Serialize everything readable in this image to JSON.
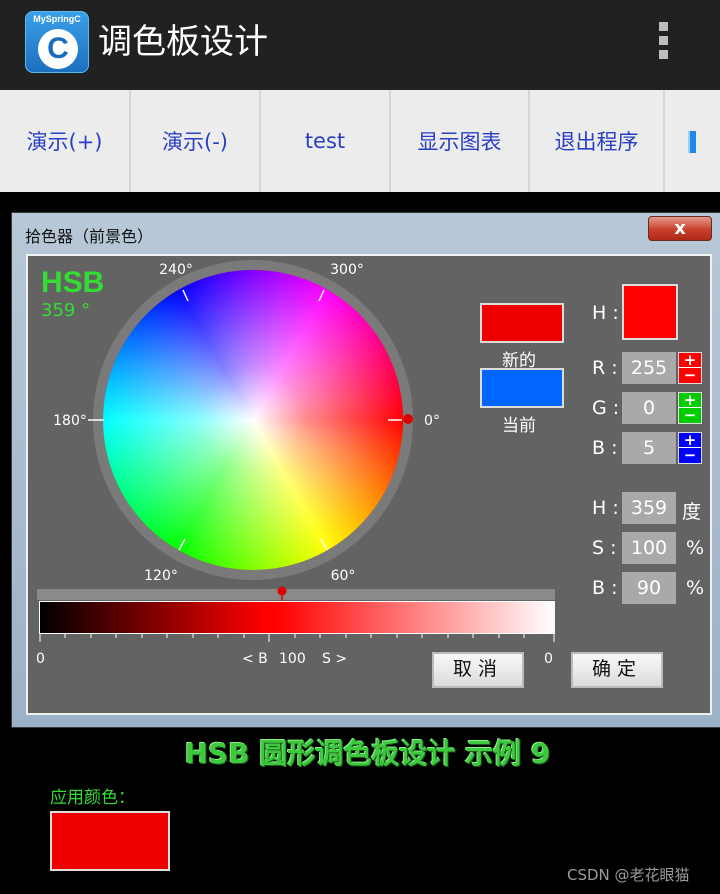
{
  "app_bar": {
    "title": "调色板设计",
    "icon_text": "MySpringC",
    "icon_letter": "C",
    "overflow_icon": "overflow-menu-icon"
  },
  "toolbar": {
    "buttons": [
      "演示(+)",
      "演示(-)",
      "test",
      "显示图表",
      "退出程序"
    ]
  },
  "dialog": {
    "title": "拾色器（前景色）",
    "close_glyph": "x",
    "mode_label": "HSB",
    "hue_readout": "359 °",
    "wheel_angles": [
      "240°",
      "300°",
      "180°",
      "0°",
      "120°",
      "60°"
    ],
    "new_label": "新的",
    "current_label": "当前",
    "new_color": "#ee0000",
    "current_color": "#0066ff",
    "preview_color": "#ff0000",
    "rgb": [
      {
        "label": "R :",
        "value": "255",
        "accent": "#ff0000"
      },
      {
        "label": "G :",
        "value": "0",
        "accent": "#00cc00"
      },
      {
        "label": "B :",
        "value": "5",
        "accent": "#0000ff"
      }
    ],
    "hsb": [
      {
        "label": "H :",
        "value": "359",
        "unit": "度"
      },
      {
        "label": "S :",
        "value": "100",
        "unit": "%"
      },
      {
        "label": "B :",
        "value": "90",
        "unit": "%"
      }
    ],
    "h_label": "H :",
    "plus_glyph": "+",
    "minus_glyph": "−",
    "scale": {
      "left": "0",
      "brightness": "< B",
      "mid": "100",
      "saturation": "S >",
      "right": "0"
    },
    "cancel_label": "取消",
    "ok_label": "确定"
  },
  "caption": "HSB 圆形调色板设计 示例 9",
  "apply": {
    "label": "应用颜色：",
    "color": "#ee0000"
  },
  "watermark": "CSDN @老花眼猫"
}
